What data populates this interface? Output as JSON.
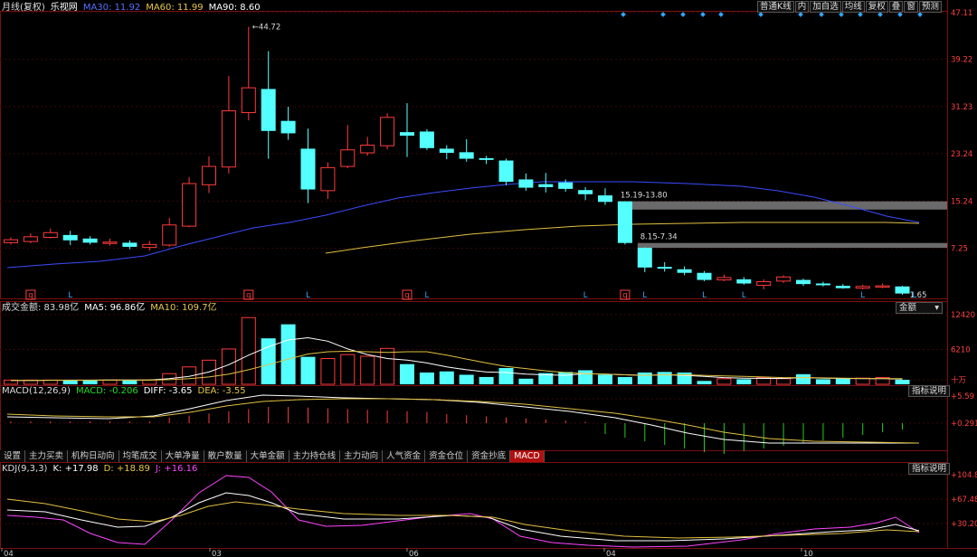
{
  "header": {
    "title": "月线(复权)",
    "stock": "乐视网",
    "ma30_label": "MA30: 11.92",
    "ma60_label": "MA60: 11.99",
    "ma90_label": "MA90: 8.60"
  },
  "toolbar": [
    "普通K线",
    "内",
    "加自选",
    "均线",
    "复权",
    "叠",
    "窗",
    "预测"
  ],
  "volume_header": {
    "label": "成交金额: 83.98亿",
    "ma5_label": "MA5: 96.86亿",
    "ma10_label": "MA10: 109.7亿",
    "selector": "金额"
  },
  "macd_header": {
    "title": "MACD(12,26,9)",
    "macd_label": "MACD: -0.206",
    "diff_label": "DIFF: -3.65",
    "dea_label": "DEA: -3.55",
    "help": "指标说明"
  },
  "kdj_header": {
    "title": "KDJ(9,3,3)",
    "k_label": "K: +17.98",
    "d_label": "D: +18.89",
    "j_label": "J: +16.16",
    "help": "指标说明"
  },
  "tabs": [
    "设置",
    "主力买卖",
    "机构日动向",
    "均笔成交",
    "大单净量",
    "散户数量",
    "大单金额",
    "主力持仓线",
    "主力动向",
    "人气资金",
    "资金仓位",
    "资金抄底",
    "MACD"
  ],
  "active_tab": "MACD",
  "colors": {
    "up": "#ff3b3b",
    "down": "#54ffff",
    "ma30": "#3a4bff",
    "ma60": "#e0c040",
    "ma90": "#ff44ff",
    "bg": "#000000"
  },
  "chart_data": [
    {
      "type": "candlestick",
      "name": "price",
      "price_axis_ticks": [
        "47.11",
        "39.22",
        "31.23",
        "23.24",
        "15.24",
        "7.25"
      ],
      "ylim": [
        0,
        47.11
      ],
      "high_annotation": "44.72",
      "low_annotation": "1.65",
      "gap_labels": [
        "15.19-13.80",
        "8.15-7.34"
      ],
      "gap_ranges": [
        [
          13.8,
          15.19
        ],
        [
          7.34,
          8.15
        ]
      ],
      "marker_labels": [
        "q",
        "L",
        "q",
        "L",
        "q",
        "L",
        "L",
        "q",
        "L",
        "L",
        "L",
        "L",
        "L"
      ],
      "candles": [
        {
          "o": 8.2,
          "c": 8.7,
          "h": 9.1,
          "l": 7.9
        },
        {
          "o": 8.4,
          "c": 9.2,
          "h": 9.8,
          "l": 8.1
        },
        {
          "o": 9.1,
          "c": 9.9,
          "h": 10.6,
          "l": 8.9
        },
        {
          "o": 9.5,
          "c": 8.6,
          "h": 10.2,
          "l": 7.8
        },
        {
          "o": 8.9,
          "c": 8.2,
          "h": 9.3,
          "l": 7.9
        },
        {
          "o": 8.1,
          "c": 8.3,
          "h": 8.9,
          "l": 7.7
        },
        {
          "o": 8.2,
          "c": 7.5,
          "h": 8.6,
          "l": 7.1
        },
        {
          "o": 7.4,
          "c": 7.9,
          "h": 8.5,
          "l": 6.9
        },
        {
          "o": 7.8,
          "c": 11.2,
          "h": 12.4,
          "l": 7.5
        },
        {
          "o": 11.0,
          "c": 18.2,
          "h": 19.3,
          "l": 10.8
        },
        {
          "o": 18.0,
          "c": 21.1,
          "h": 22.8,
          "l": 16.6
        },
        {
          "o": 21.0,
          "c": 30.5,
          "h": 36.4,
          "l": 19.9
        },
        {
          "o": 30.2,
          "c": 34.4,
          "h": 44.72,
          "l": 28.9
        },
        {
          "o": 34.2,
          "c": 27.1,
          "h": 40.6,
          "l": 22.4
        },
        {
          "o": 28.8,
          "c": 26.7,
          "h": 31.2,
          "l": 25.6
        },
        {
          "o": 24.1,
          "c": 17.2,
          "h": 27.5,
          "l": 14.9
        },
        {
          "o": 17.0,
          "c": 20.9,
          "h": 21.8,
          "l": 15.6
        },
        {
          "o": 21.1,
          "c": 23.9,
          "h": 28.1,
          "l": 20.8
        },
        {
          "o": 23.4,
          "c": 24.7,
          "h": 26.1,
          "l": 22.9
        },
        {
          "o": 24.6,
          "c": 29.4,
          "h": 30.1,
          "l": 24.0
        },
        {
          "o": 26.9,
          "c": 26.3,
          "h": 31.8,
          "l": 22.7
        },
        {
          "o": 27.0,
          "c": 24.2,
          "h": 27.4,
          "l": 23.9
        },
        {
          "o": 24.1,
          "c": 23.4,
          "h": 24.7,
          "l": 22.3
        },
        {
          "o": 23.5,
          "c": 22.4,
          "h": 25.7,
          "l": 21.9
        },
        {
          "o": 22.5,
          "c": 22.2,
          "h": 22.9,
          "l": 21.5
        },
        {
          "o": 22.1,
          "c": 18.5,
          "h": 22.4,
          "l": 17.9
        },
        {
          "o": 18.9,
          "c": 17.5,
          "h": 19.9,
          "l": 17.0
        },
        {
          "o": 18.1,
          "c": 17.6,
          "h": 20.0,
          "l": 16.7
        },
        {
          "o": 18.4,
          "c": 17.3,
          "h": 18.9,
          "l": 16.8
        },
        {
          "o": 17.1,
          "c": 16.4,
          "h": 17.6,
          "l": 15.4
        },
        {
          "o": 16.2,
          "c": 15.1,
          "h": 17.4,
          "l": 14.6
        },
        {
          "o": 15.19,
          "c": 8.15,
          "h": 15.19,
          "l": 7.9
        },
        {
          "o": 7.34,
          "c": 4.0,
          "h": 7.4,
          "l": 3.2
        },
        {
          "o": 4.1,
          "c": 3.8,
          "h": 4.9,
          "l": 3.3
        },
        {
          "o": 3.7,
          "c": 3.1,
          "h": 4.2,
          "l": 2.7
        },
        {
          "o": 3.1,
          "c": 1.9,
          "h": 3.4,
          "l": 1.7
        },
        {
          "o": 1.9,
          "c": 2.3,
          "h": 2.8,
          "l": 1.7
        },
        {
          "o": 2.0,
          "c": 1.3,
          "h": 2.4,
          "l": 1.1
        },
        {
          "o": 1.0,
          "c": 1.6,
          "h": 2.0,
          "l": 0.3
        },
        {
          "o": 1.7,
          "c": 2.4,
          "h": 2.7,
          "l": 1.4
        },
        {
          "o": 1.9,
          "c": 1.2,
          "h": 2.1,
          "l": 0.9
        },
        {
          "o": 1.3,
          "c": 1.0,
          "h": 1.6,
          "l": 0.8
        },
        {
          "o": 0.9,
          "c": 0.5,
          "h": 1.2,
          "l": 0.4
        },
        {
          "o": 0.5,
          "c": 0.8,
          "h": 1.1,
          "l": 0.3
        },
        {
          "o": 0.7,
          "c": 0.9,
          "h": 1.3,
          "l": 0.5
        },
        {
          "o": 0.8,
          "c": -0.4,
          "h": 0.9,
          "l": -0.6
        }
      ],
      "ma30": [
        null,
        null,
        null,
        null,
        null,
        null,
        null,
        null,
        null,
        null,
        null,
        null,
        null,
        null,
        null,
        null,
        null,
        null,
        null,
        null,
        null,
        null,
        null,
        null,
        null,
        null,
        null,
        null,
        null,
        null,
        15.3,
        14.9,
        14.3,
        13.4,
        12.6
      ],
      "ma60": []
    },
    {
      "type": "bar",
      "name": "turnover",
      "axis_ticks": [
        "12420",
        "6210",
        "十万"
      ],
      "ylim": [
        0,
        12420
      ],
      "values": [
        750,
        750,
        750,
        780,
        760,
        750,
        750,
        760,
        1900,
        3100,
        4300,
        6300,
        11900,
        8200,
        10700,
        4900,
        4600,
        5300,
        5000,
        6400,
        3600,
        2100,
        2300,
        1700,
        1300,
        2900,
        1000,
        2000,
        2200,
        2500,
        1700,
        1300,
        2100,
        2200,
        2100,
        600,
        1000,
        900,
        1200,
        1000,
        1800,
        900,
        1000,
        1100,
        1200,
        800
      ],
      "ma5": [
        700,
        700,
        720,
        740,
        750,
        760,
        760,
        780,
        1000,
        1400,
        2200,
        3500,
        5200,
        6700,
        7900,
        8300,
        7700,
        6300,
        5300,
        4600,
        4300,
        3800,
        3100,
        2600,
        2200,
        2100,
        1800,
        1700,
        1600,
        1900,
        1800,
        1700,
        1600,
        1700,
        1600,
        1400,
        1200,
        1100,
        1050,
        1050,
        1200,
        1100,
        1050,
        1000,
        1000,
        920
      ],
      "ma10": [
        700,
        700,
        710,
        720,
        730,
        740,
        750,
        750,
        820,
        1000,
        1300,
        1800,
        2600,
        3500,
        4500,
        5400,
        5800,
        5900,
        5800,
        5700,
        5800,
        5800,
        5200,
        4500,
        3800,
        3200,
        2800,
        2400,
        2100,
        1900,
        1800,
        1700,
        1600,
        1700,
        1700,
        1600,
        1500,
        1400,
        1300,
        1200,
        1200,
        1150,
        1100,
        1050,
        1030,
        1020
      ],
      "labels": [
        "成交金额",
        "MA5",
        "MA10"
      ]
    }
  ]
}
